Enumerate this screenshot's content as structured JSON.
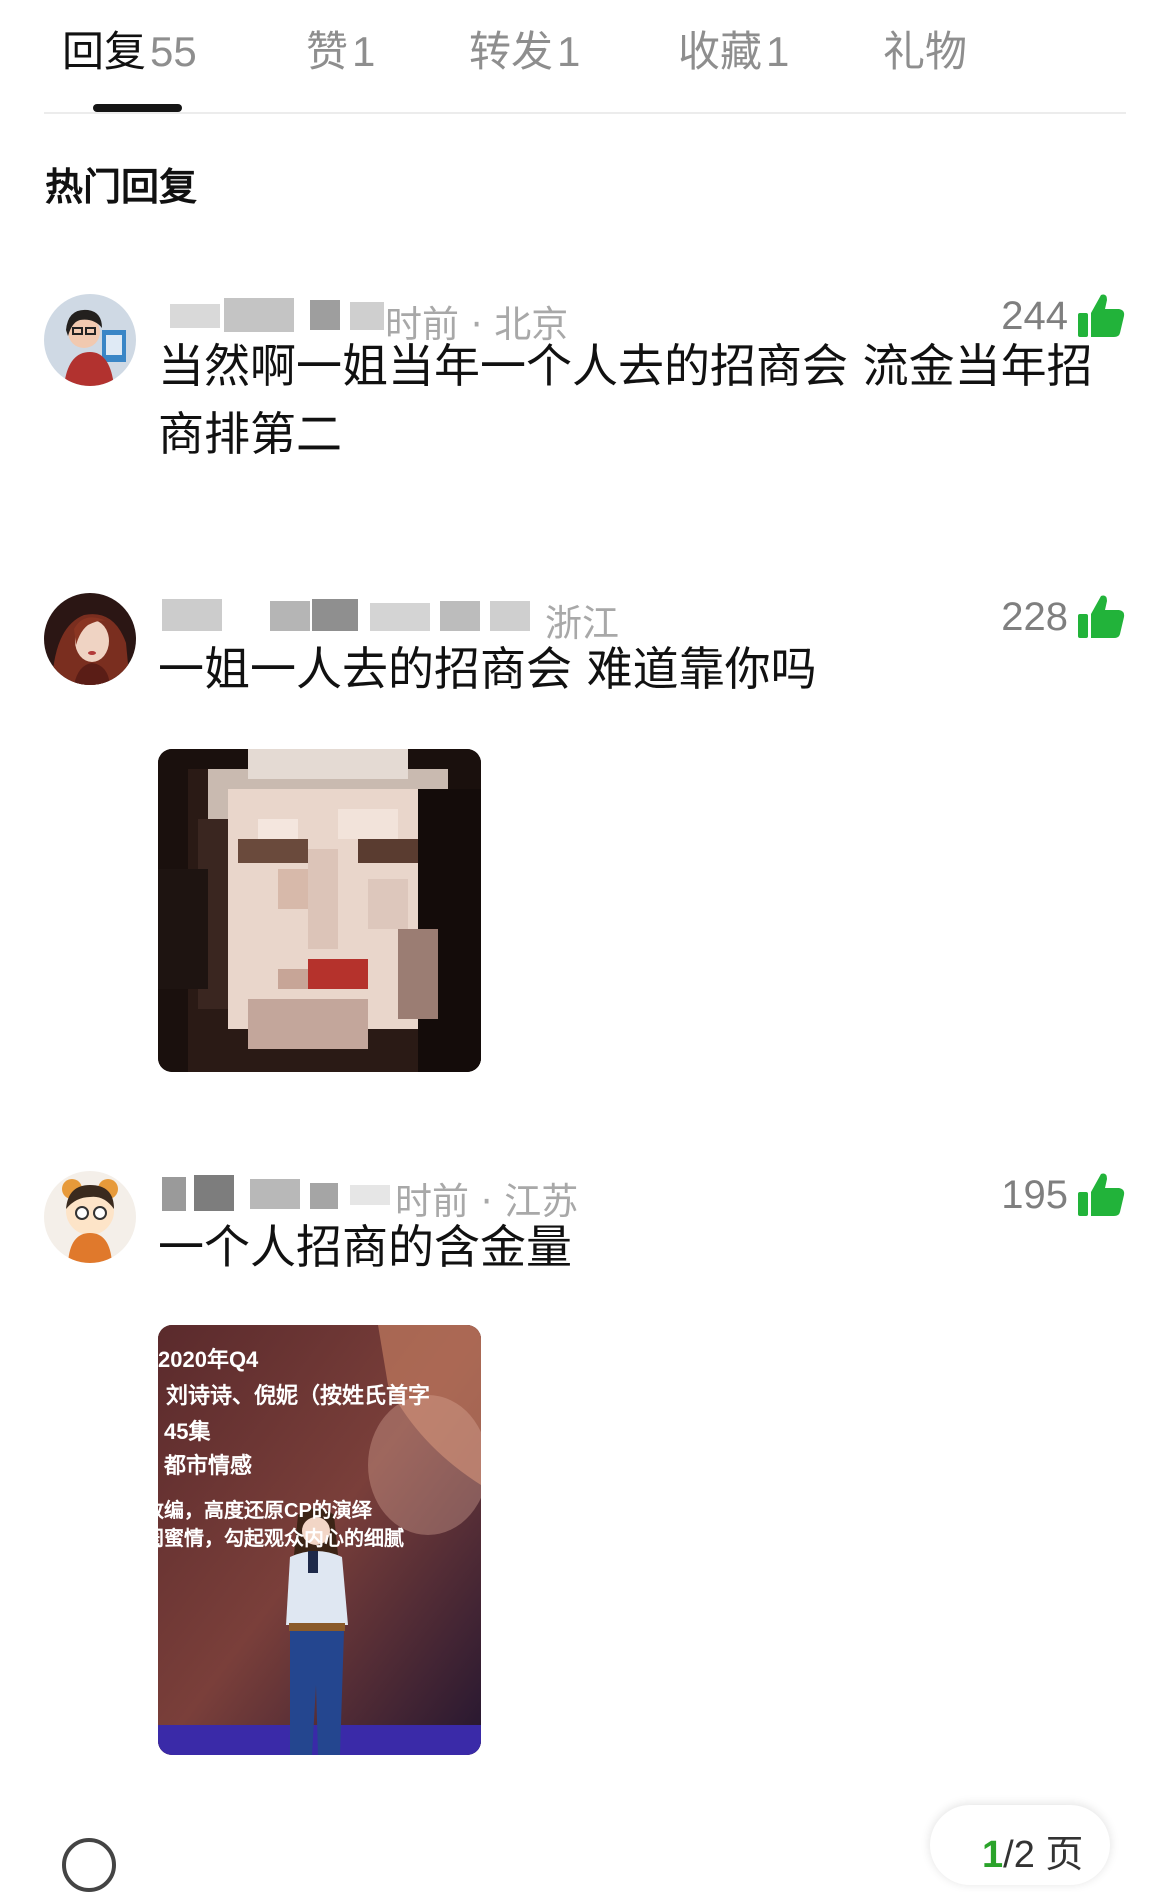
{
  "tabs": [
    {
      "label": "回复",
      "count": "55"
    },
    {
      "label": "赞",
      "count": "1"
    },
    {
      "label": "转发",
      "count": "1"
    },
    {
      "label": "收藏",
      "count": "1"
    },
    {
      "label": "礼物",
      "count": ""
    }
  ],
  "section_title": "热门回复",
  "comments": [
    {
      "username": "",
      "meta": "时前 · 北京",
      "likes": "244",
      "text": "当然啊一姐当年一个人去的招商会 流金当年招商排第二"
    },
    {
      "username": "",
      "meta": "浙江",
      "likes": "228",
      "text": "一姐一人去的招商会 难道靠你吗"
    },
    {
      "username": "",
      "meta": "时前 · 江苏",
      "likes": "195",
      "text": "一个人招商的含金量",
      "image_lines": [
        "2020年Q4",
        "刘诗诗、倪妮（按姓氏首字",
        "45集",
        "都市情感",
        "改编，高度还原CP的演绎",
        "闺蜜情，勾起观众内心的细腻"
      ]
    }
  ],
  "pagination": {
    "current": "1",
    "rest": "/2 页"
  },
  "colors": {
    "accent_like": "#22b33a",
    "active_tab": "#111111",
    "muted": "#8e8e8e"
  }
}
